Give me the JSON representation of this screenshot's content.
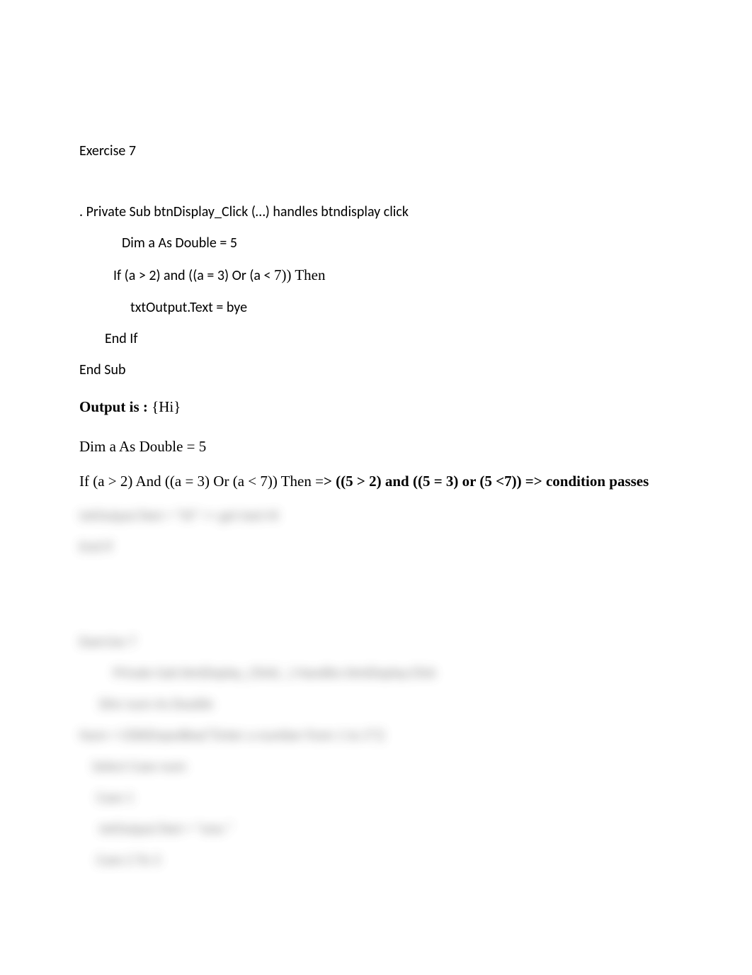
{
  "doc": {
    "ex7_title": "Exercise 7",
    "line_private_sub": ". Private Sub btnDisplay_Click (…) handles btndisplay click",
    "line_dim": "Dim a As Double = 5",
    "line_if_sans": "If (a > 2) and ((a = 3) Or (a < ",
    "line_if_serif_suffix": "7)) Then",
    "line_txtoutput": "txtOutput.Text = bye",
    "line_endif": "End If",
    "line_endsub": "End Sub",
    "output_label": "Output is : ",
    "output_value": "{Hi}",
    "line_dim_serif": "Dim a As Double = 5",
    "line_ifcond_prefix": "If (a > 2) And ((a = 3) Or (a < 7)) Then =",
    "line_ifcond_bold": "> ((5 > 2) and ((5 = 3) or (5 <7)) => condition passes",
    "blurred": {
      "l1": "txtOutput.Text = \"Hi\" => get text Hi",
      "l2": "End If",
      "ex_title": "Exercise 7",
      "l3": "Private Sub btnDisplay_Click(…) Handles btnDisplay.Click",
      "l4": "Dim num As Double",
      "l5": "Num = CDbl(InputBox(\"Enter a number from 1 to 3\"))",
      "l6": "Select Case num",
      "l7": "Case 1",
      "l8": "txtOutput.Text = \"one.\"",
      "l9": "Case 2 To 3"
    }
  }
}
